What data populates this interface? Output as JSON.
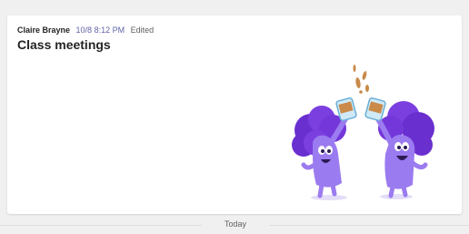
{
  "message": {
    "author": "Claire Brayne",
    "timestamp": "10/8 8:12 PM",
    "edited_label": "Edited",
    "title": "Class meetings"
  },
  "divider": {
    "label": "Today"
  },
  "illustration": {
    "name": "cheers-characters-illustration"
  },
  "colors": {
    "accent": "#6264a7",
    "character_purple": "#8e6cf0",
    "hair_purple": "#7b3fe0",
    "background": "#f0f0f0"
  }
}
